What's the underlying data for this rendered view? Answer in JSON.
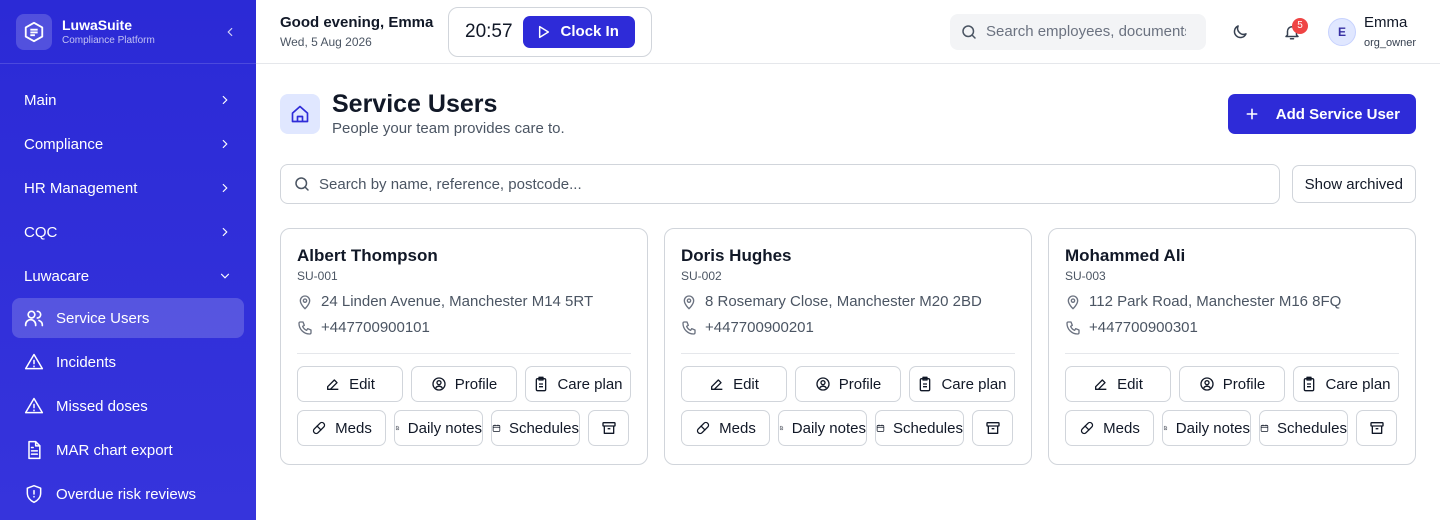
{
  "brand": {
    "name": "LuwaSuite",
    "subtitle": "Compliance Platform"
  },
  "sidebar": {
    "groups": [
      {
        "label": "Main"
      },
      {
        "label": "Compliance"
      },
      {
        "label": "HR Management"
      },
      {
        "label": "CQC"
      },
      {
        "label": "Luwacare"
      }
    ],
    "items": [
      {
        "label": "Service Users",
        "icon": "users-icon",
        "active": true
      },
      {
        "label": "Incidents",
        "icon": "warning-icon"
      },
      {
        "label": "Missed doses",
        "icon": "warning-icon"
      },
      {
        "label": "MAR chart export",
        "icon": "document-icon"
      },
      {
        "label": "Overdue risk reviews",
        "icon": "shield-icon"
      }
    ]
  },
  "header": {
    "greeting": "Good evening, Emma",
    "date": "Wed, 5 Aug 2026",
    "clock_time": "20:57",
    "clock_in_label": "Clock In",
    "search_placeholder": "Search employees, documents...",
    "notification_count": "5",
    "user_initial": "E",
    "user_name": "Emma",
    "user_role": "org_owner"
  },
  "page": {
    "title": "Service Users",
    "subtitle": "People your team provides care to.",
    "add_label": "Add Service User",
    "search_placeholder": "Search by name, reference, postcode...",
    "show_archived_label": "Show archived"
  },
  "card_actions": {
    "edit": "Edit",
    "profile": "Profile",
    "care_plan": "Care plan",
    "meds": "Meds",
    "daily_notes": "Daily notes",
    "schedules": "Schedules"
  },
  "service_users": [
    {
      "name": "Albert Thompson",
      "ref": "SU-001",
      "address": "24 Linden Avenue, Manchester M14 5RT",
      "phone": "+447700900101"
    },
    {
      "name": "Doris Hughes",
      "ref": "SU-002",
      "address": "8 Rosemary Close, Manchester M20 2BD",
      "phone": "+447700900201"
    },
    {
      "name": "Mohammed Ali",
      "ref": "SU-003",
      "address": "112 Park Road, Manchester M16 8FQ",
      "phone": "+447700900301"
    }
  ],
  "colors": {
    "primary": "#2e2bd8",
    "sidebar": "#2f2cd8",
    "badge": "#ef4444"
  }
}
